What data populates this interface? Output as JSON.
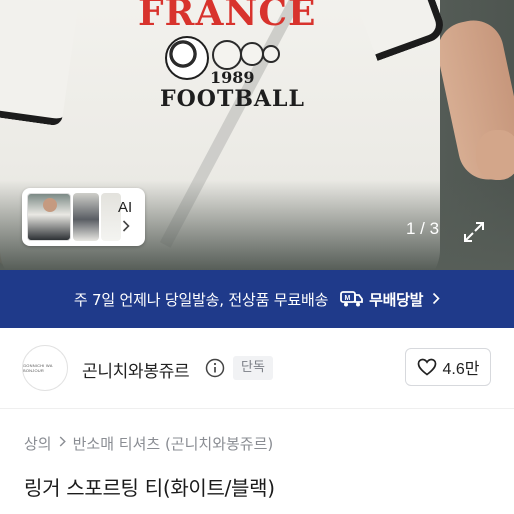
{
  "gallery": {
    "shirt_print_top": "FRANCE",
    "shirt_print_year": "1989",
    "shirt_print_bottom": "FOOTBALL",
    "ai_label": "AI",
    "current_index": "1",
    "total": "3",
    "counter_text": "1 / 3"
  },
  "promo": {
    "text": "주 7일 언제나 당일발송, 전상품 무료배송",
    "free_shipping_label": "무배당발",
    "background_color": "#1f3a8a"
  },
  "shop": {
    "logo_text": "GONNICHI WA BONJOUR",
    "name": "곤니치와봉쥬르",
    "badge": "단독",
    "like_count": "4.6만"
  },
  "breadcrumb": {
    "items": [
      "상의",
      "반소매 티셔츠 (곤니치와봉쥬르)"
    ]
  },
  "product": {
    "title": "링거 스포르팅 티(화이트/블랙)"
  },
  "icons": {
    "expand": "expand-icon",
    "info": "info-icon",
    "heart": "heart-icon",
    "truck": "truck-icon",
    "chevron": "chevron-right-icon"
  }
}
